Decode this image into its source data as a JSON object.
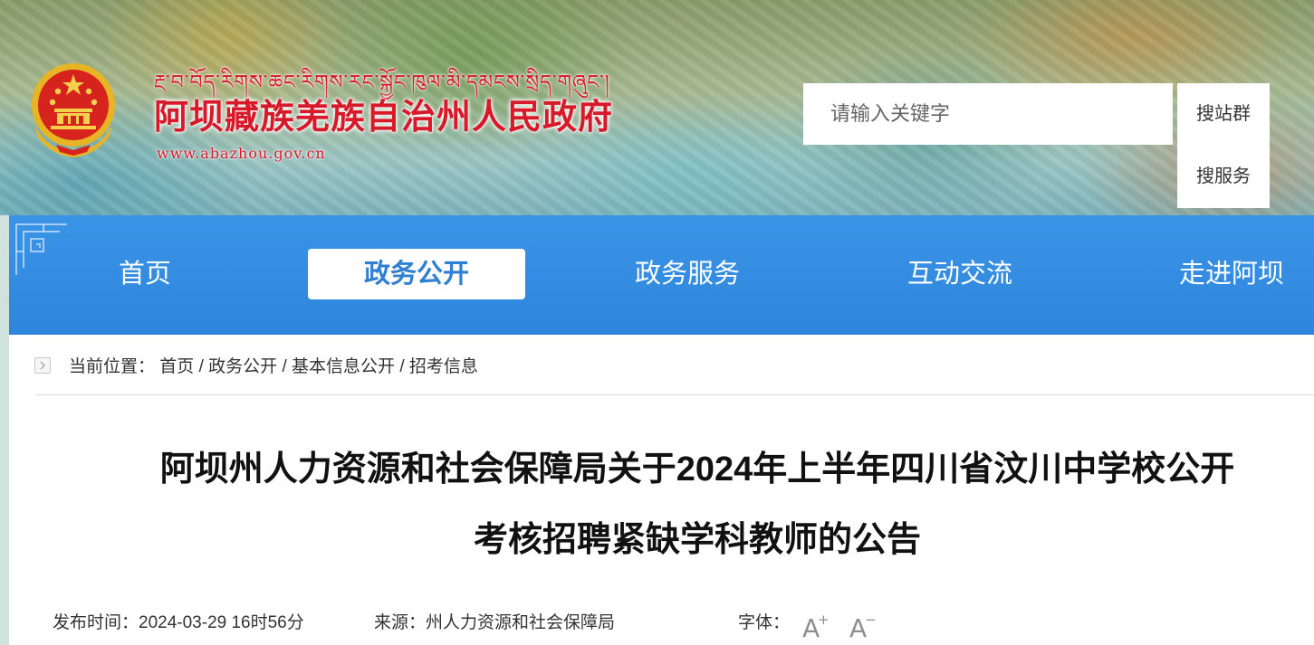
{
  "header": {
    "tibetan_title": "རྔ་བ་བོད་རིགས་ཆང་རིགས་རང་སྐྱོང་ཁུལ་མི་དམངས་སྲིད་གཞུང་།",
    "site_title": "阿坝藏族羌族自治州人民政府",
    "url": "www.abazhou.gov.cn"
  },
  "search": {
    "placeholder": "请输入关键字",
    "btn_site_group": "搜站群",
    "btn_service": "搜服务"
  },
  "nav": {
    "items": [
      {
        "label": "首页"
      },
      {
        "label": "政务公开",
        "active": true
      },
      {
        "label": "政务服务"
      },
      {
        "label": "互动交流"
      },
      {
        "label": "走进阿坝"
      }
    ]
  },
  "breadcrumb": {
    "prefix": "当前位置：",
    "items": [
      "首页",
      "政务公开",
      "基本信息公开",
      "招考信息"
    ],
    "separator": "/"
  },
  "article": {
    "title_line1": "阿坝州人力资源和社会保障局关于2024年上半年四川省汶川中学校公开",
    "title_line2": "考核招聘紧缺学科教师的公告",
    "publish_label": "发布时间：",
    "publish_time": "2024-03-29 16时56分",
    "source_label": "来源：",
    "source": "州人力资源和社会保障局",
    "font_label": "字体：",
    "font_increase": "A",
    "font_increase_sign": "+",
    "font_decrease": "A",
    "font_decrease_sign": "−"
  },
  "colors": {
    "brand_red": "#d7192a",
    "nav_blue": "#2f86dd",
    "active_text": "#2f7fd3"
  }
}
